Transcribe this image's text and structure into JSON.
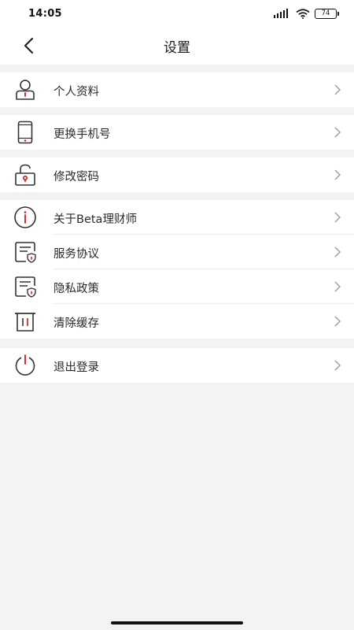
{
  "status": {
    "time": "14:05",
    "battery": "74"
  },
  "nav": {
    "title": "设置"
  },
  "groups": [
    {
      "items": [
        {
          "label": "个人资料",
          "icon": "person-icon"
        }
      ]
    },
    {
      "items": [
        {
          "label": "更换手机号",
          "icon": "phone-icon"
        }
      ]
    },
    {
      "items": [
        {
          "label": "修改密码",
          "icon": "lock-icon"
        }
      ]
    },
    {
      "items": [
        {
          "label": "关于Beta理财师",
          "icon": "info-icon"
        },
        {
          "label": "服务协议",
          "icon": "agreement-icon"
        },
        {
          "label": "隐私政策",
          "icon": "privacy-policy-icon"
        },
        {
          "label": "清除缓存",
          "icon": "trash-icon"
        }
      ]
    },
    {
      "items": [
        {
          "label": "退出登录",
          "icon": "power-icon"
        }
      ]
    }
  ],
  "colors": {
    "accent": "#c8161d",
    "icon_stroke": "#333333",
    "chevron": "#9a9a9a"
  }
}
